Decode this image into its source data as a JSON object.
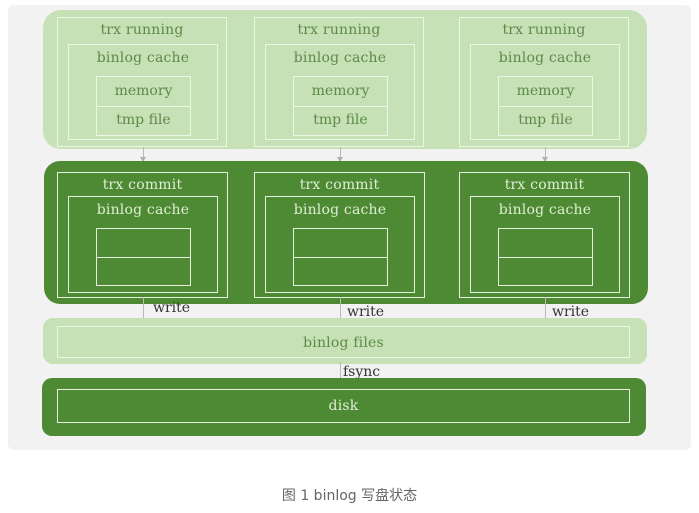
{
  "running_columns": [
    {
      "title": "trx running",
      "cache": "binlog cache",
      "memory": "memory",
      "tmp_file": "tmp file"
    },
    {
      "title": "trx running",
      "cache": "binlog cache",
      "memory": "memory",
      "tmp_file": "tmp file"
    },
    {
      "title": "trx running",
      "cache": "binlog cache",
      "memory": "memory",
      "tmp_file": "tmp file"
    }
  ],
  "commit_columns": [
    {
      "title": "trx commit",
      "cache": "binlog cache"
    },
    {
      "title": "trx commit",
      "cache": "binlog cache"
    },
    {
      "title": "trx commit",
      "cache": "binlog cache"
    }
  ],
  "write_labels": [
    "write",
    "write",
    "write"
  ],
  "binlog_files_label": "binlog files",
  "fsync_label": "fsync",
  "disk_label": "disk",
  "caption": "图 1 binlog 写盘状态",
  "colors": {
    "light_band": "#c6e1b5",
    "dark_band": "#4e8a34",
    "light_text": "#5d8a48",
    "dark_text": "#dfeed5"
  }
}
